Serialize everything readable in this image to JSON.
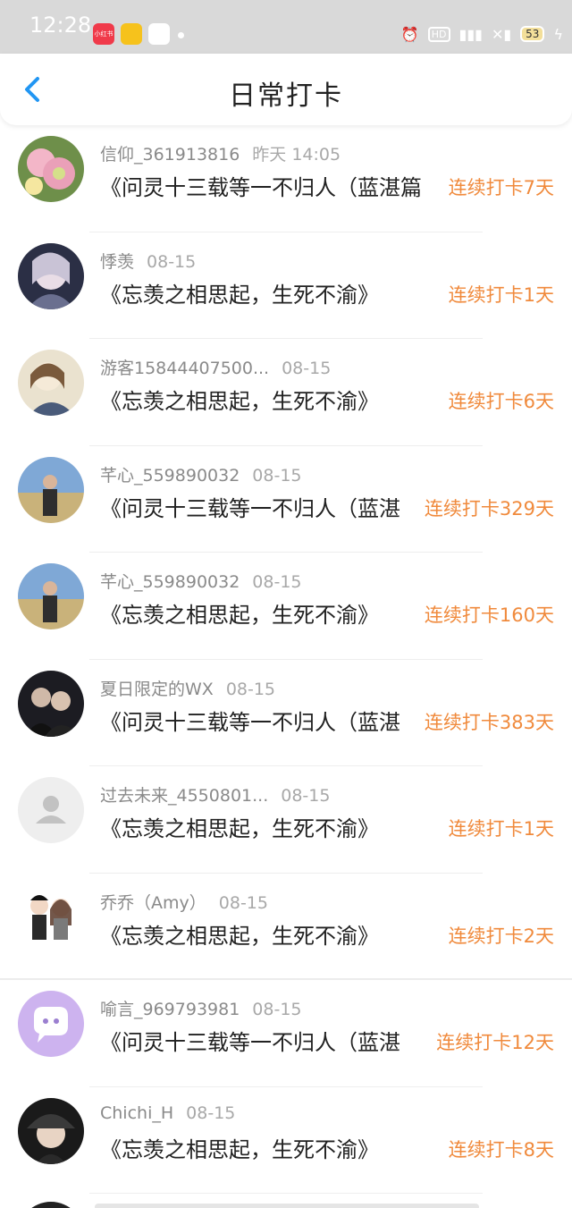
{
  "status": {
    "time": "12:28",
    "app1_label": "小红书",
    "battery": "53"
  },
  "header": {
    "title": "日常打卡"
  },
  "rows": [
    {
      "name": "信仰_361913816",
      "date": "昨天 14:05",
      "content": "《问灵十三载等一不归人（蓝湛篇",
      "streak": "连续打卡7天",
      "avatar": "flowers-avatar"
    },
    {
      "name": "悸羡",
      "date": "08-15",
      "content": "《忘羡之相思起，生死不渝》",
      "streak": "连续打卡1天",
      "avatar": "anime-girl-avatar"
    },
    {
      "name": "游客15844407500...",
      "date": "08-15",
      "content": "《忘羡之相思起，生死不渝》",
      "streak": "连续打卡6天",
      "avatar": "illustration-avatar"
    },
    {
      "name": "芊心_559890032",
      "date": "08-15",
      "content": "《问灵十三载等一不归人（蓝湛",
      "streak": "连续打卡329天",
      "avatar": "seaside-person-avatar"
    },
    {
      "name": "芊心_559890032",
      "date": "08-15",
      "content": "《忘羡之相思起，生死不渝》",
      "streak": "连续打卡160天",
      "avatar": "seaside-person-avatar"
    },
    {
      "name": "夏日限定的WX",
      "date": "08-15",
      "content": "《问灵十三载等一不归人（蓝湛",
      "streak": "连续打卡383天",
      "avatar": "couple-photo-avatar"
    },
    {
      "name": "过去未来_4550801...",
      "date": "08-15",
      "content": "《忘羡之相思起，生死不渝》",
      "streak": "连续打卡1天",
      "avatar": "default-user-avatar"
    },
    {
      "name": "乔乔（Amy）",
      "date": "08-15",
      "content": "《忘羡之相思起，生死不渝》",
      "streak": "连续打卡2天",
      "avatar": "cartoon-couple-avatar"
    },
    {
      "name": "喻言_969793981",
      "date": "08-15",
      "content": "《问灵十三载等一不归人（蓝湛",
      "streak": "连续打卡12天",
      "avatar": "chat-bubble-avatar"
    },
    {
      "name": "Chichi_H",
      "date": "08-15",
      "content": "《忘羡之相思起，生死不渝》",
      "streak": "连续打卡8天",
      "avatar": "hat-person-avatar"
    }
  ],
  "colors": {
    "accent": "#f08a3c",
    "back": "#2196f3"
  }
}
